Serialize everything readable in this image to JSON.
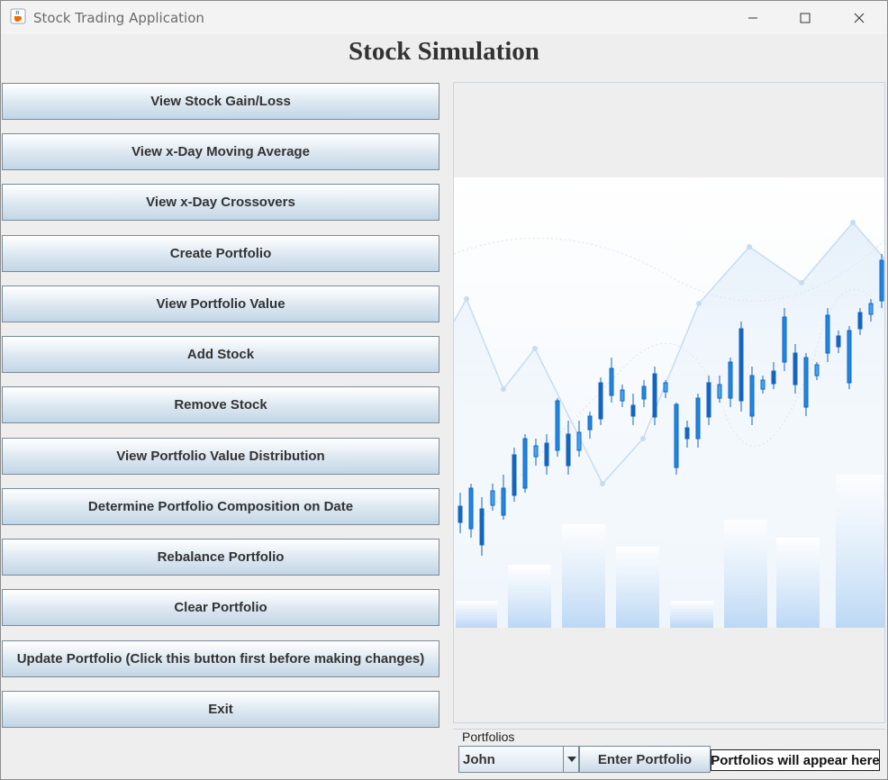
{
  "window": {
    "title": "Stock Trading Application",
    "app_icon": "java-coffee-cup-icon"
  },
  "header": {
    "title": "Stock Simulation"
  },
  "menu": {
    "buttons": [
      {
        "label": "View Stock Gain/Loss"
      },
      {
        "label": "View x-Day Moving Average"
      },
      {
        "label": "View x-Day Crossovers"
      },
      {
        "label": "Create Portfolio"
      },
      {
        "label": "View Portfolio Value"
      },
      {
        "label": "Add Stock"
      },
      {
        "label": "Remove Stock"
      },
      {
        "label": "View Portfolio Value Distribution"
      },
      {
        "label": "Determine Portfolio Composition on Date"
      },
      {
        "label": "Rebalance Portfolio"
      },
      {
        "label": "Clear Portfolio"
      },
      {
        "label": "Update Portfolio (Click this button first before making changes)"
      },
      {
        "label": "Exit"
      }
    ]
  },
  "portfolios": {
    "group_label": "Portfolios",
    "selected": "John",
    "enter_button": "Enter Portfolio",
    "status": "Portfolios will appear here"
  },
  "colors": {
    "accent": "#1e88e5",
    "button_top": "#ffffff",
    "button_bottom": "#c3d6e6"
  }
}
